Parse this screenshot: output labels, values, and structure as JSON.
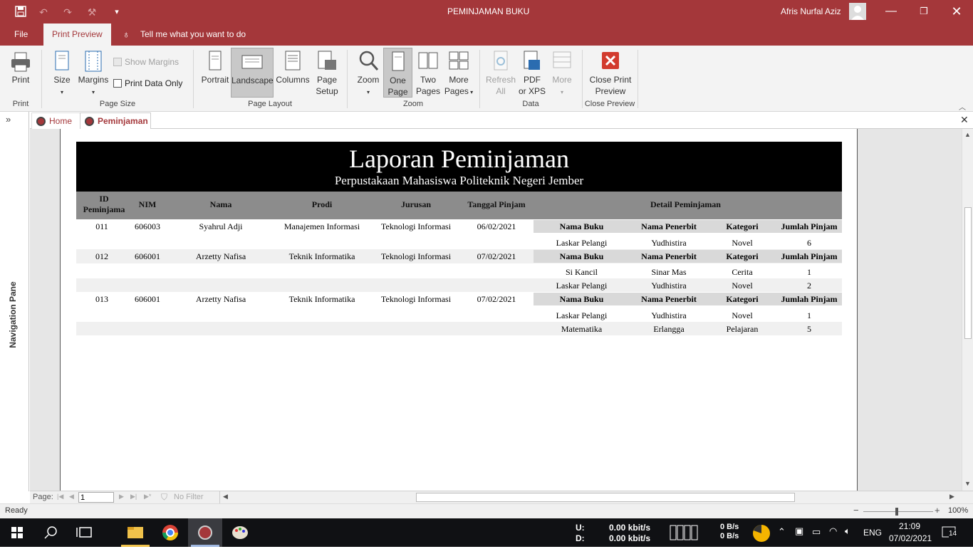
{
  "window": {
    "title": "PEMINJAMAN BUKU",
    "user": "Afris Nurfal Aziz"
  },
  "ribbon_tabs": {
    "file": "File",
    "print_preview": "Print Preview",
    "tell_me": "Tell me what you want to do"
  },
  "ribbon": {
    "print": "Print",
    "size": "Size",
    "margins": "Margins",
    "show_margins": "Show Margins",
    "print_data_only": "Print Data Only",
    "portrait": "Portrait",
    "landscape": "Landscape",
    "columns": "Columns",
    "page_setup_1": "Page",
    "page_setup_2": "Setup",
    "zoom": "Zoom",
    "one_page_1": "One",
    "one_page_2": "Page",
    "two_pages_1": "Two",
    "two_pages_2": "Pages",
    "more_pages_1": "More",
    "more_pages_2": "Pages",
    "refresh_all_1": "Refresh",
    "refresh_all_2": "All",
    "pdf_xps_1": "PDF",
    "pdf_xps_2": "or XPS",
    "more": "More",
    "close_print_preview_1": "Close Print",
    "close_print_preview_2": "Preview",
    "groups": {
      "print": "Print",
      "page_size": "Page Size",
      "page_layout": "Page Layout",
      "zoom": "Zoom",
      "data": "Data",
      "close_preview": "Close Preview"
    }
  },
  "doc_tabs": [
    "Home",
    "Peminjaman"
  ],
  "nav_pane_label": "Navigation Pane",
  "report": {
    "title": "Laporan Peminjaman",
    "subtitle": "Perpustakaan Mahasiswa Politeknik Negeri Jember",
    "headers": {
      "id_1": "ID",
      "id_2": "Peminjama",
      "nim": "NIM",
      "nama": "Nama",
      "prodi": "Prodi",
      "jurusan": "Jurusan",
      "tanggal": "Tanggal Pinjam",
      "detail": "Detail Peminjaman"
    },
    "sub_headers": {
      "buku": "Nama Buku",
      "penerbit": "Nama Penerbit",
      "kategori": "Kategori",
      "jumlah": "Jumlah Pinjam"
    },
    "rows": [
      {
        "id": "011",
        "nim": "606003",
        "nama": "Syahrul Adji",
        "prodi": "Manajemen Informasi",
        "jurusan": "Teknologi Informasi",
        "tanggal": "06/02/2021",
        "details": [
          {
            "buku": "Laskar Pelangi",
            "penerbit": "Yudhistira",
            "kategori": "Novel",
            "jumlah": "6"
          }
        ]
      },
      {
        "id": "012",
        "nim": "606001",
        "nama": "Arzetty Nafisa",
        "prodi": "Teknik Informatika",
        "jurusan": "Teknologi Informasi",
        "tanggal": "07/02/2021",
        "details": [
          {
            "buku": "Si Kancil",
            "penerbit": "Sinar Mas",
            "kategori": "Cerita",
            "jumlah": "1"
          },
          {
            "buku": "Laskar Pelangi",
            "penerbit": "Yudhistira",
            "kategori": "Novel",
            "jumlah": "2"
          }
        ]
      },
      {
        "id": "013",
        "nim": "606001",
        "nama": "Arzetty Nafisa",
        "prodi": "Teknik Informatika",
        "jurusan": "Teknologi Informasi",
        "tanggal": "07/02/2021",
        "details": [
          {
            "buku": "Laskar Pelangi",
            "penerbit": "Yudhistira",
            "kategori": "Novel",
            "jumlah": "1"
          },
          {
            "buku": "Matematika",
            "penerbit": "Erlangga",
            "kategori": "Pelajaran",
            "jumlah": "5"
          }
        ]
      }
    ]
  },
  "record_nav": {
    "label": "Page:",
    "value": "1",
    "filter": "No Filter"
  },
  "status": {
    "text": "Ready",
    "zoom": "100%"
  },
  "taskbar": {
    "net_u_label": "U:",
    "net_d_label": "D:",
    "net_u": "0.00 kbit/s",
    "net_d": "0.00 kbit/s",
    "disk1": "0 B/s",
    "disk2": "0 B/s",
    "lang": "ENG",
    "time": "21:09",
    "date": "07/02/2021",
    "notif": "14"
  }
}
